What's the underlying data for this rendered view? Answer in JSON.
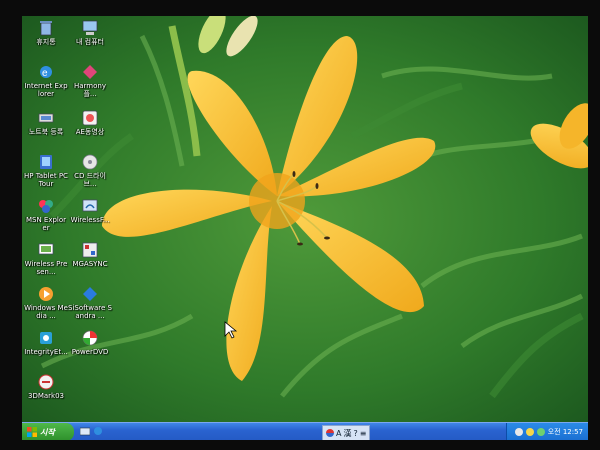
{
  "desktop": {
    "icons": [
      {
        "label": "휴지통",
        "icon": "recycle-bin-icon"
      },
      {
        "label": "내 컴퓨터",
        "icon": "my-computer-icon"
      },
      {
        "label": "Internet Explorer",
        "icon": "internet-explorer-icon"
      },
      {
        "label": "Harmony 플...",
        "icon": "harmony-icon"
      },
      {
        "label": "노트북 등록",
        "icon": "notebook-register-icon"
      },
      {
        "label": "AE동영상",
        "icon": "video-player-icon"
      },
      {
        "label": "HP Tablet PC Tour",
        "icon": "tablet-tour-icon"
      },
      {
        "label": "CD 드라이브...",
        "icon": "cd-drive-icon"
      },
      {
        "label": "MSN Explorer",
        "icon": "msn-explorer-icon"
      },
      {
        "label": "WirelessF...",
        "icon": "wireless-icon"
      },
      {
        "label": "Wireless Presen...",
        "icon": "wireless-presentation-icon"
      },
      {
        "label": "MGASYNC",
        "icon": "mgasync-icon"
      },
      {
        "label": "Windows Media ...",
        "icon": "windows-media-icon"
      },
      {
        "label": "SiSoftware Sandra ...",
        "icon": "sisoftware-icon"
      },
      {
        "label": "IntegrityEt...",
        "icon": "integrity-icon"
      },
      {
        "label": "PowerDVD",
        "icon": "powerdvd-icon"
      },
      {
        "label": "3DMark03",
        "icon": "3dmark-icon"
      }
    ]
  },
  "taskbar": {
    "start_label": "시작",
    "ime_items": [
      "A",
      "漢",
      "?",
      "≡"
    ],
    "clock": "오전 12:57"
  },
  "colors": {
    "petal": "#f8c23a",
    "taskbar": "#2a63d0",
    "start": "#3aa035"
  }
}
